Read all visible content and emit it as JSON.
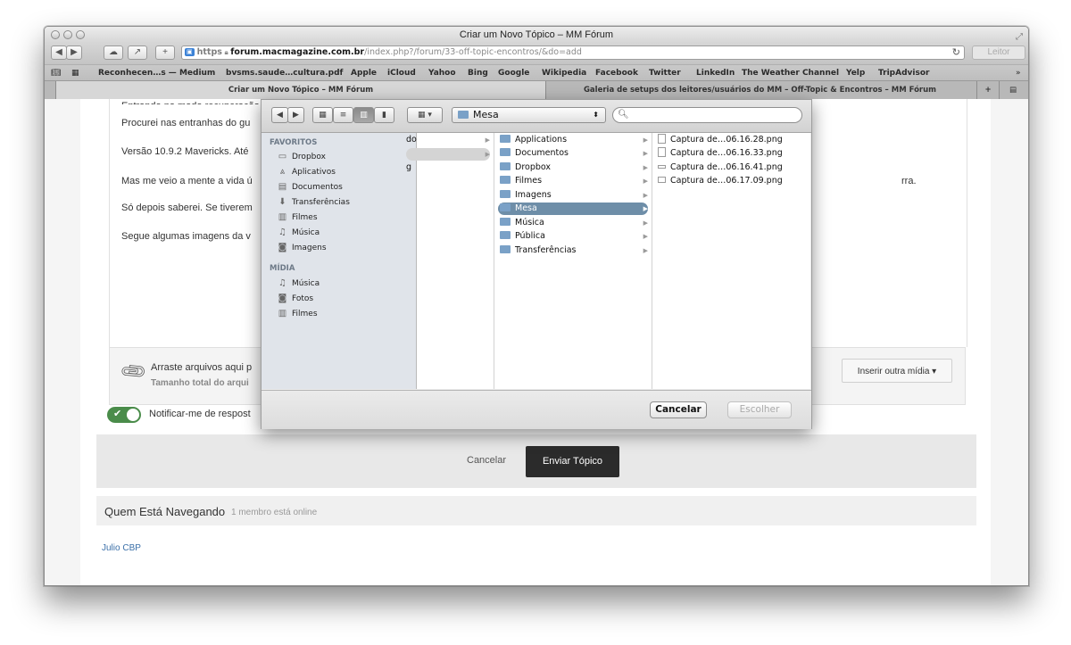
{
  "window": {
    "title": "Criar um Novo Tópico – MM Fórum"
  },
  "toolbar": {
    "url_scheme": "https",
    "url_host": "forum.macmagazine.com.br",
    "url_path": "/index.php?/forum/33-off-topic-encontros/&do=add",
    "reader_label": "Leitor"
  },
  "bookmarks": [
    "Reconhecen…s — Medium",
    "bvsms.saude…cultura.pdf",
    "Apple",
    "iCloud",
    "Yahoo",
    "Bing",
    "Google",
    "Wikipedia",
    "Facebook",
    "Twitter",
    "LinkedIn",
    "The Weather Channel",
    "Yelp",
    "TripAdvisor"
  ],
  "tabs": [
    {
      "label": "Criar um Novo Tópico – MM Fórum"
    },
    {
      "label": "Galeria de setups dos leitores/usuários do MM – Off-Topic & Encontros – MM Fórum"
    }
  ],
  "editor": {
    "paragraphs": [
      "Procurei nas entranhas do gu",
      "Versão 10.9.2 Mavericks. Até",
      "Mas me veio a mente a vida ú",
      "Só depois saberei. Se tiverem",
      "Segue algumas imagens da v"
    ],
    "trailing_text": "rra."
  },
  "attach": {
    "text": "Arraste arquivos aqui p",
    "subtext": "Tamanho total do arqui",
    "insert_label": "Inserir outra mídia ▾"
  },
  "notify_label": "Notificar-me de respost",
  "submit": {
    "cancel_label": "Cancelar",
    "submit_label": "Enviar Tópico"
  },
  "whos": {
    "title": "Quem Está Navegando",
    "count": "1 membro está online",
    "user": "Julio CBP"
  },
  "dialog": {
    "location": "Mesa",
    "favorites_header": "FAVORITOS",
    "favorites": [
      {
        "label": "Dropbox",
        "icon": "folder"
      },
      {
        "label": "Aplicativos",
        "icon": "apps"
      },
      {
        "label": "Documentos",
        "icon": "document"
      },
      {
        "label": "Transferências",
        "icon": "download"
      },
      {
        "label": "Filmes",
        "icon": "film"
      },
      {
        "label": "Música",
        "icon": "music"
      },
      {
        "label": "Imagens",
        "icon": "camera"
      }
    ],
    "media_header": "MÍDIA",
    "media": [
      {
        "label": "Música",
        "icon": "music"
      },
      {
        "label": "Fotos",
        "icon": "camera"
      },
      {
        "label": "Filmes",
        "icon": "film"
      }
    ],
    "col1_fragments": [
      "do",
      "g"
    ],
    "folders": [
      "Applications",
      "Documentos",
      "Dropbox",
      "Filmes",
      "Imagens",
      "Mesa",
      "Música",
      "Pública",
      "Transferências"
    ],
    "selected_folder": "Mesa",
    "files": [
      "Captura de…06.16.28.png",
      "Captura de…06.16.33.png",
      "Captura de…06.16.41.png",
      "Captura de…06.17.09.png"
    ],
    "cancel_label": "Cancelar",
    "choose_label": "Escolher"
  }
}
